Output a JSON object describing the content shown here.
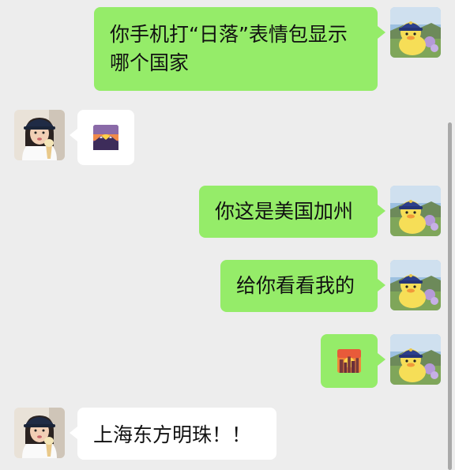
{
  "messages": [
    {
      "sender": "me",
      "type": "text",
      "text": "你手机打“日落”表情包显示哪个国家"
    },
    {
      "sender": "friend",
      "type": "emoji",
      "emoji": "sunrise-over-mountains"
    },
    {
      "sender": "me",
      "type": "text",
      "text": "你这是美国加州"
    },
    {
      "sender": "me",
      "type": "text",
      "text": "给你看看我的"
    },
    {
      "sender": "me",
      "type": "emoji",
      "emoji": "sunset-city"
    },
    {
      "sender": "friend",
      "type": "text",
      "text": "上海东方明珠！！"
    }
  ],
  "colors": {
    "background": "#ededed",
    "my_bubble": "#95ec69",
    "friend_bubble": "#ffffff"
  }
}
